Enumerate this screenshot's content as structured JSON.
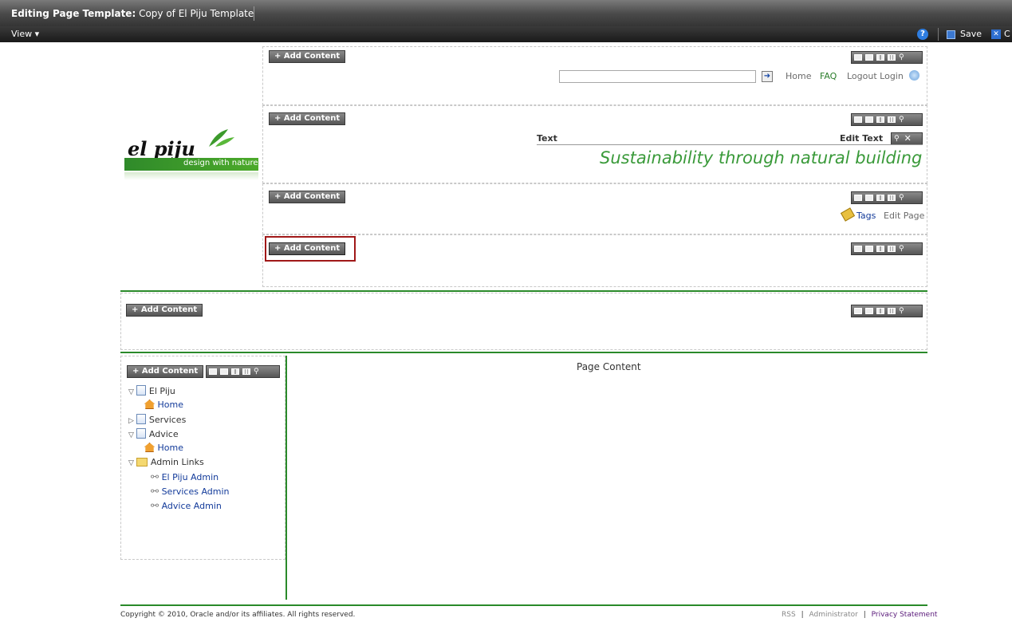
{
  "titlebar": {
    "label": "Editing Page Template:",
    "name": "Copy of El Piju Template"
  },
  "viewbar": {
    "view_label": "View",
    "help": "?",
    "save_label": "Save",
    "close_label": "C"
  },
  "logo": {
    "brand": "el piju",
    "tagline": "design with nature"
  },
  "add_content_label": "+ Add Content",
  "header": {
    "search_placeholder": "",
    "links": [
      "Home",
      "FAQ",
      "Logout Login"
    ]
  },
  "text_block": {
    "label": "Text",
    "edit_label": "Edit Text",
    "tagline": "Sustainability through natural building"
  },
  "tags_row": {
    "tags_label": "Tags",
    "edit_page_label": "Edit Page"
  },
  "page_content_label": "Page Content",
  "tree": {
    "items": [
      {
        "label": "El Piju",
        "expanded": true,
        "kind": "page"
      },
      {
        "label": "Home",
        "kind": "home"
      },
      {
        "label": "Services",
        "expanded": false,
        "kind": "page"
      },
      {
        "label": "Advice",
        "expanded": true,
        "kind": "page"
      },
      {
        "label": "Home",
        "kind": "home"
      },
      {
        "label": "Admin Links",
        "expanded": true,
        "kind": "folder"
      },
      {
        "label": "El Piju Admin",
        "kind": "link"
      },
      {
        "label": "Services Admin",
        "kind": "link"
      },
      {
        "label": "Advice Admin",
        "kind": "link"
      }
    ]
  },
  "footer": {
    "copyright": "Copyright © 2010, Oracle and/or its affiliates. All rights reserved.",
    "rss": "RSS",
    "administrator": "Administrator",
    "privacy": "Privacy Statement",
    "separator": "|"
  },
  "colors": {
    "accent_green": "#2a8a2a",
    "tagline_green": "#3a9a3a",
    "highlight_red": "#a01818"
  }
}
